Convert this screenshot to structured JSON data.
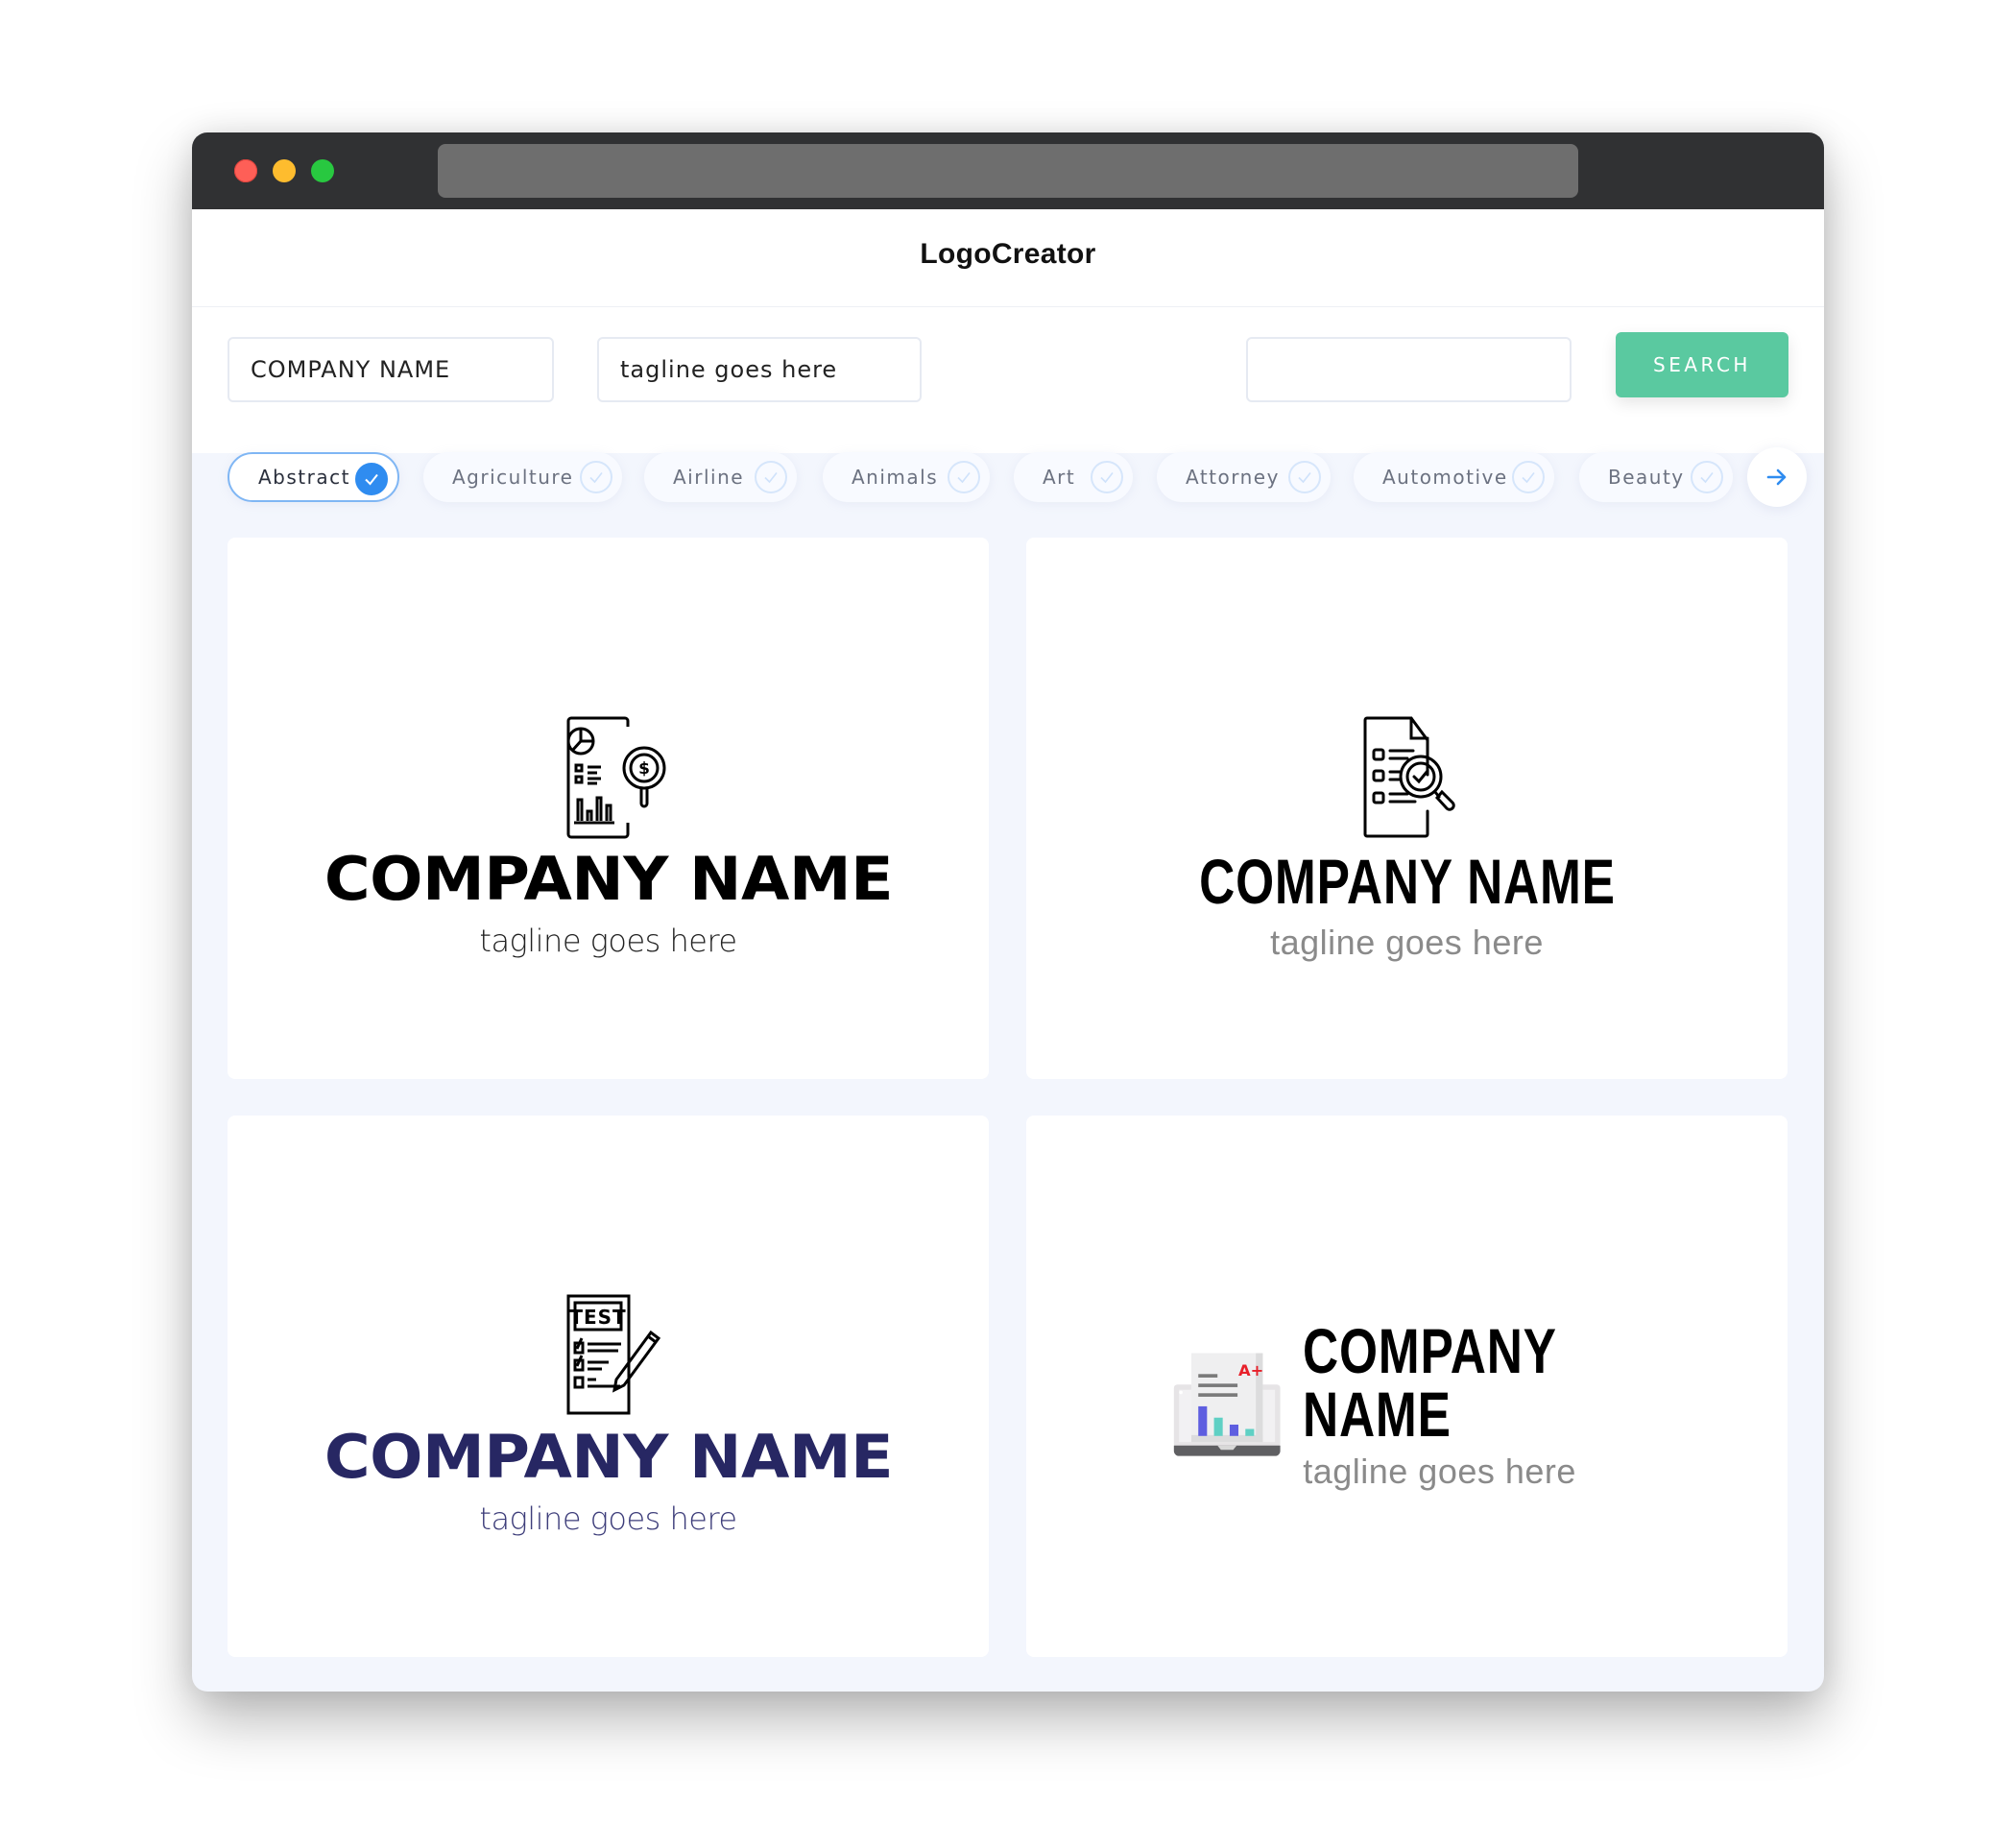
{
  "window": {
    "traffic_lights": [
      "close",
      "minimize",
      "maximize"
    ],
    "address_bar": ""
  },
  "header": {
    "title": "LogoCreator"
  },
  "search": {
    "company_name_value": "COMPANY NAME",
    "tagline_value": "tagline goes here",
    "keyword_value": "",
    "button_label": "SEARCH",
    "button_color": "#5ac9a0"
  },
  "categories": {
    "items": [
      {
        "label": "Abstract",
        "selected": true
      },
      {
        "label": "Agriculture",
        "selected": false
      },
      {
        "label": "Airline",
        "selected": false
      },
      {
        "label": "Animals",
        "selected": false
      },
      {
        "label": "Art",
        "selected": false
      },
      {
        "label": "Attorney",
        "selected": false
      },
      {
        "label": "Automotive",
        "selected": false
      },
      {
        "label": "Beauty",
        "selected": false
      }
    ],
    "next_icon": "arrow-right-icon",
    "accent_color": "#2f8cf0"
  },
  "logos": [
    {
      "icon": "financial-report-magnifier-dollar-icon",
      "company_name": "COMPANY NAME",
      "tagline": "tagline goes here",
      "name_color": "#000000",
      "tagline_color": "#222222",
      "layout": "stacked"
    },
    {
      "icon": "checklist-document-magnifier-icon",
      "company_name": "COMPANY NAME",
      "tagline": "tagline goes here",
      "name_color": "#000000",
      "tagline_color": "#8a8a8a",
      "layout": "stacked"
    },
    {
      "icon": "test-paper-pencil-icon",
      "company_name": "COMPANY NAME",
      "tagline": "tagline goes here",
      "name_color": "#272763",
      "tagline_color": "#3d3d7a",
      "layout": "stacked"
    },
    {
      "icon": "laptop-report-a-plus-icon",
      "company_name": "COMPANY NAME",
      "tagline": "tagline goes here",
      "name_color": "#000000",
      "tagline_color": "#8a8a8a",
      "layout": "horizontal",
      "icon_text": "A+"
    }
  ]
}
